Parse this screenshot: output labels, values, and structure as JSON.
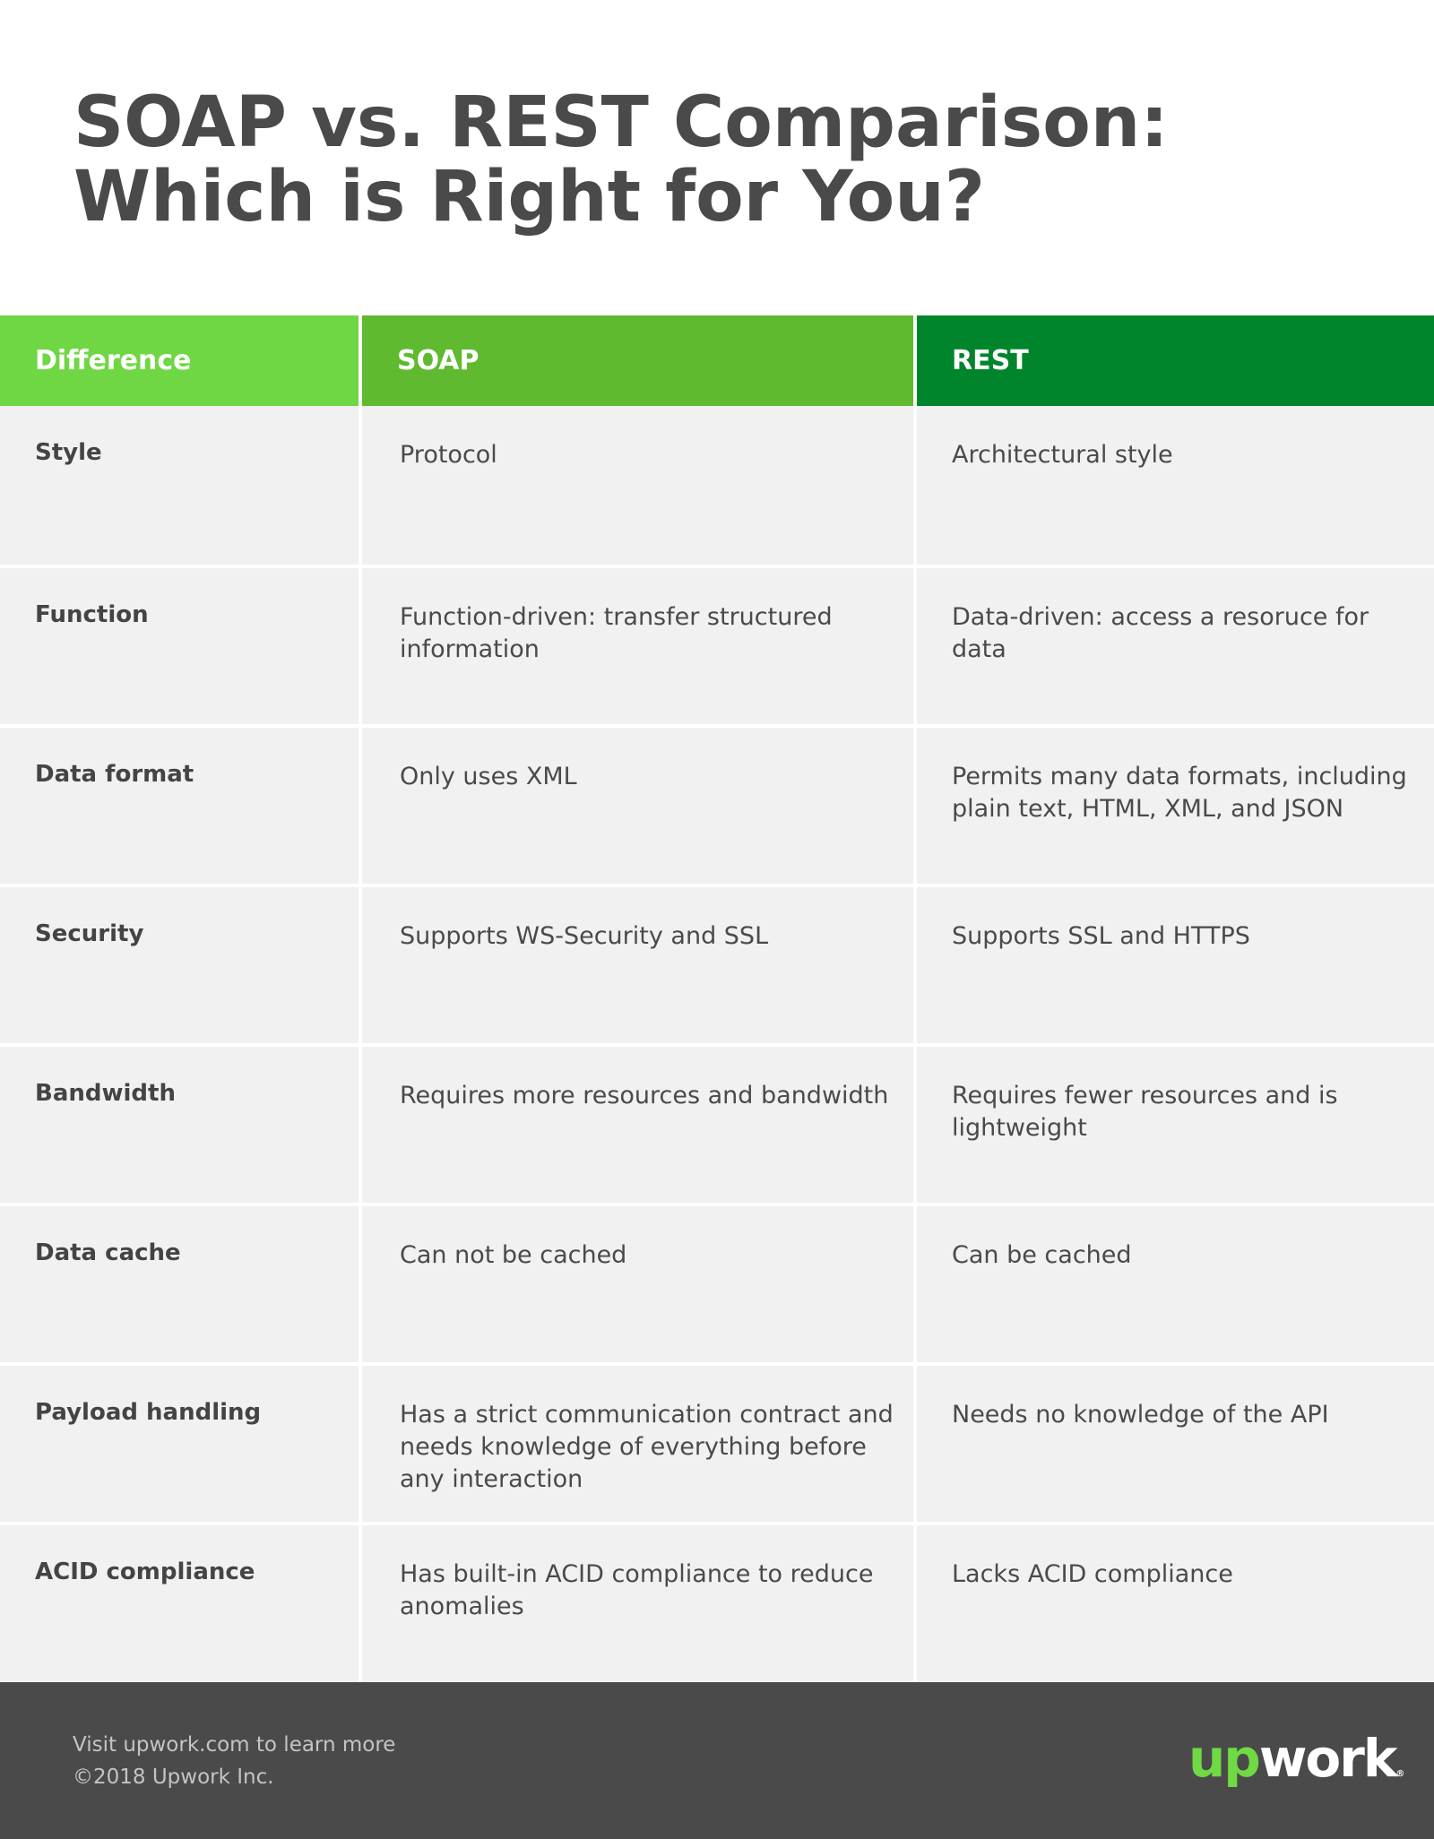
{
  "title": {
    "line1": "SOAP vs. REST Comparison:",
    "line2": "Which is Right for You?"
  },
  "colors": {
    "header_difference": "#6fd744",
    "header_soap": "#5fba2f",
    "header_rest": "#00852c",
    "cell_background": "#f1f1f1",
    "footer_background": "#4a4a4a",
    "logo_green": "#6fda44"
  },
  "table": {
    "headers": [
      "Difference",
      "SOAP",
      "REST"
    ],
    "rows": [
      {
        "difference": "Style",
        "soap": "Protocol",
        "rest": "Architectural style"
      },
      {
        "difference": "Function",
        "soap": "Function-driven: transfer structured information",
        "rest": "Data-driven: access a resoruce for data"
      },
      {
        "difference": "Data format",
        "soap": "Only uses XML",
        "rest": "Permits many data formats, including plain text, HTML, XML, and JSON"
      },
      {
        "difference": "Security",
        "soap": "Supports WS-Security and SSL",
        "rest": "Supports SSL and HTTPS"
      },
      {
        "difference": "Bandwidth",
        "soap": "Requires more resources and bandwidth",
        "rest": "Requires fewer resources and is lightweight"
      },
      {
        "difference": "Data cache",
        "soap": "Can not be cached",
        "rest": "Can be cached"
      },
      {
        "difference": "Payload handling",
        "soap": "Has a strict communication contract and needs knowledge of everything before any interaction",
        "rest": "Needs no knowledge of the API"
      },
      {
        "difference": "ACID compliance",
        "soap": "Has built-in ACID compliance to reduce anomalies",
        "rest": "Lacks ACID compliance"
      }
    ]
  },
  "footer": {
    "line1": "Visit upwork.com to learn more",
    "line2": "©2018 Upwork Inc.",
    "logo": {
      "up": "up",
      "work": "work",
      "mark": "®"
    }
  }
}
